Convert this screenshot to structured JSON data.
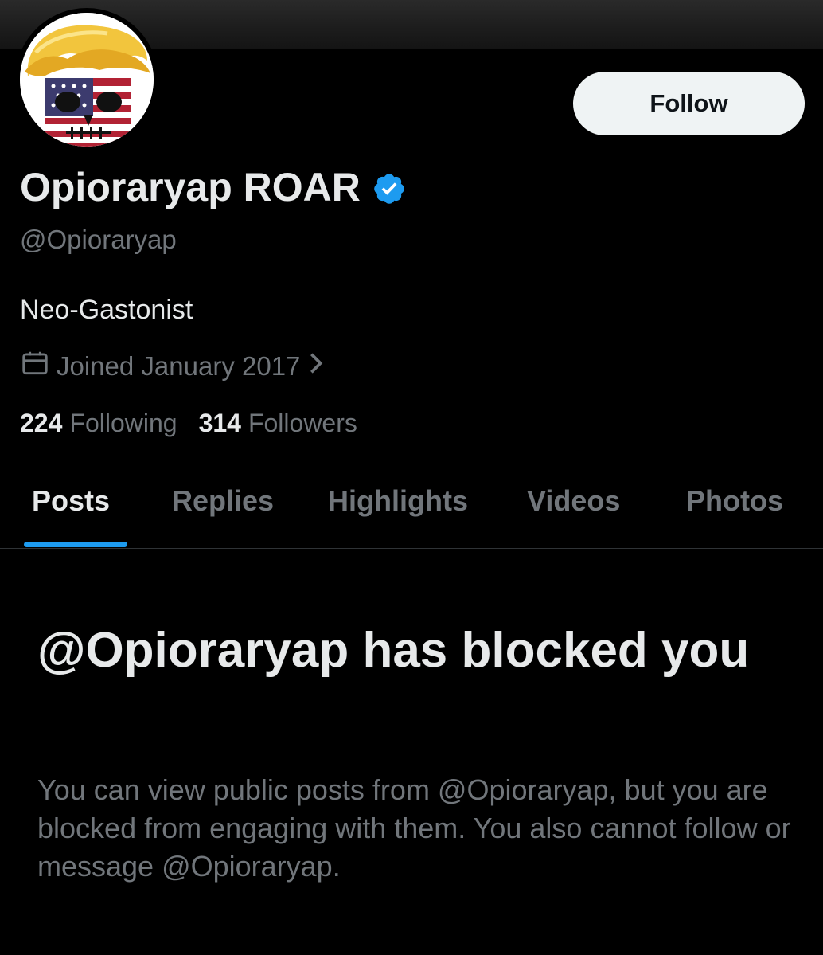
{
  "profile": {
    "display_name": "Opioraryap ROAR",
    "handle": "@Opioraryap",
    "bio": "Neo-Gastonist",
    "joined": "Joined January 2017",
    "follow_label": "Follow",
    "verified_color": "#1d9bf0"
  },
  "stats": {
    "following_count": "224",
    "following_label": "Following",
    "followers_count": "314",
    "followers_label": "Followers"
  },
  "tabs": [
    {
      "label": "Posts",
      "active": true
    },
    {
      "label": "Replies",
      "active": false
    },
    {
      "label": "Highlights",
      "active": false
    },
    {
      "label": "Videos",
      "active": false
    },
    {
      "label": "Photos",
      "active": false
    }
  ],
  "blocked": {
    "title": "@Opioraryap has blocked you",
    "description": "You can view public posts from @Opioraryap, but you are blocked from engaging with them. You also cannot follow or message @Opioraryap."
  },
  "icons": {
    "avatar": "avatar-image",
    "verified": "verified-badge-icon",
    "calendar": "calendar-icon",
    "chevron": "chevron-right-icon"
  }
}
